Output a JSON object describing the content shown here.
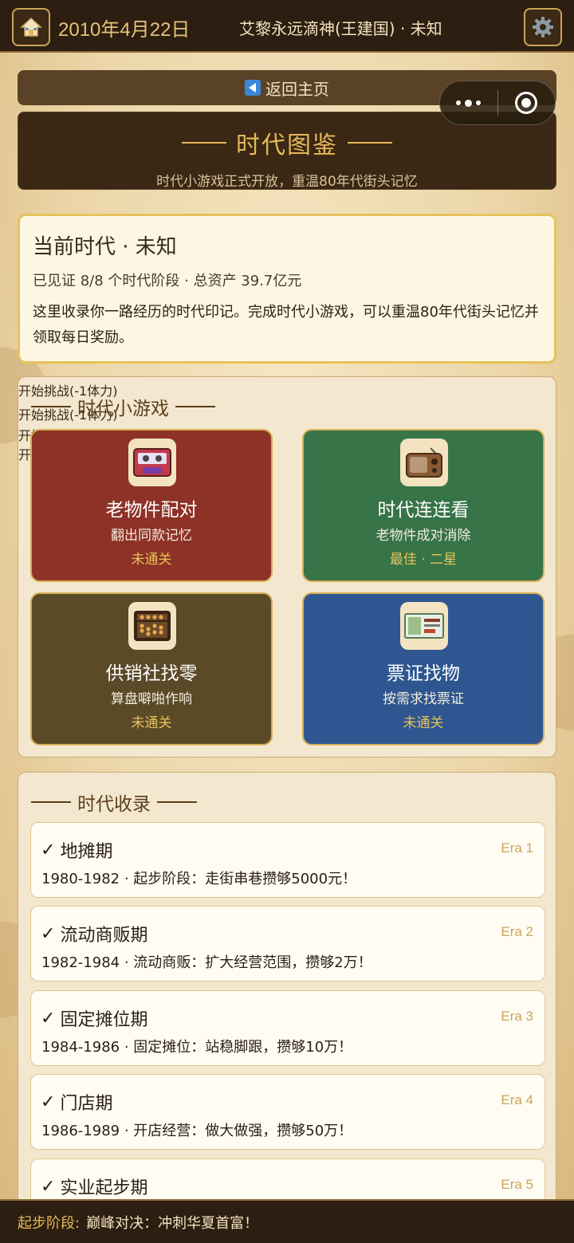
{
  "topbar": {
    "home_icon": "home-icon",
    "date": "2010年4月22日",
    "user": "艾黎永远滴神(王建国) · 未知",
    "settings_icon": "gear-icon"
  },
  "back": {
    "label": "返回主页",
    "icon": "back-arrow-icon"
  },
  "capsule": {
    "more_icon": "more-dots-icon",
    "close_icon": "target-icon"
  },
  "banner": {
    "title": "时代图鉴",
    "subtitle": "时代小游戏正式开放，重温80年代街头记忆"
  },
  "current_era": {
    "title": "当前时代 · 未知",
    "stats": "已见证 8/8 个时代阶段 · 总资产 39.7亿元",
    "description": "这里收录你一路经历的时代印记。完成时代小游戏，可以重温80年代街头记忆并领取每日奖励。"
  },
  "games_section": {
    "title": "时代小游戏",
    "games": [
      {
        "name": "老物件配对",
        "desc": "翻出同款记忆",
        "status": "未通关",
        "button": "开始挑战(-1体力)",
        "icon": "cassette-tape-icon",
        "color": "#8e3126"
      },
      {
        "name": "时代连连看",
        "desc": "老物件成对消除",
        "status": "最佳 · 二星",
        "button": "开始挑战(-1体力)",
        "icon": "radio-icon",
        "color": "#377448"
      },
      {
        "name": "供销社找零",
        "desc": "算盘噼啪作响",
        "status": "未通关",
        "button": "开始挑战(-1体力)",
        "icon": "abacus-icon",
        "color": "#5a4a28"
      },
      {
        "name": "票证找物",
        "desc": "按需求找票证",
        "status": "未通关",
        "button": "开始挑战(-1体力)",
        "icon": "ration-ticket-icon",
        "color": "#2f5690"
      }
    ]
  },
  "records_section": {
    "title": "时代收录",
    "records": [
      {
        "check": "✓",
        "name": "地摊期",
        "era": "Era 1",
        "desc": "1980-1982 · 起步阶段：走街串巷攒够5000元！"
      },
      {
        "check": "✓",
        "name": "流动商贩期",
        "era": "Era 2",
        "desc": "1982-1984 · 流动商贩：扩大经营范围，攒够2万！"
      },
      {
        "check": "✓",
        "name": "固定摊位期",
        "era": "Era 3",
        "desc": "1984-1986 · 固定摊位：站稳脚跟，攒够10万！"
      },
      {
        "check": "✓",
        "name": "门店期",
        "era": "Era 4",
        "desc": "1986-1989 · 开店经营：做大做强，攒够50万！"
      },
      {
        "check": "✓",
        "name": "实业起步期",
        "era": "Era 5",
        "desc": ""
      }
    ]
  },
  "ticker": {
    "label": "起步阶段:",
    "text": "巅峰对决：冲刺华夏首富！"
  }
}
